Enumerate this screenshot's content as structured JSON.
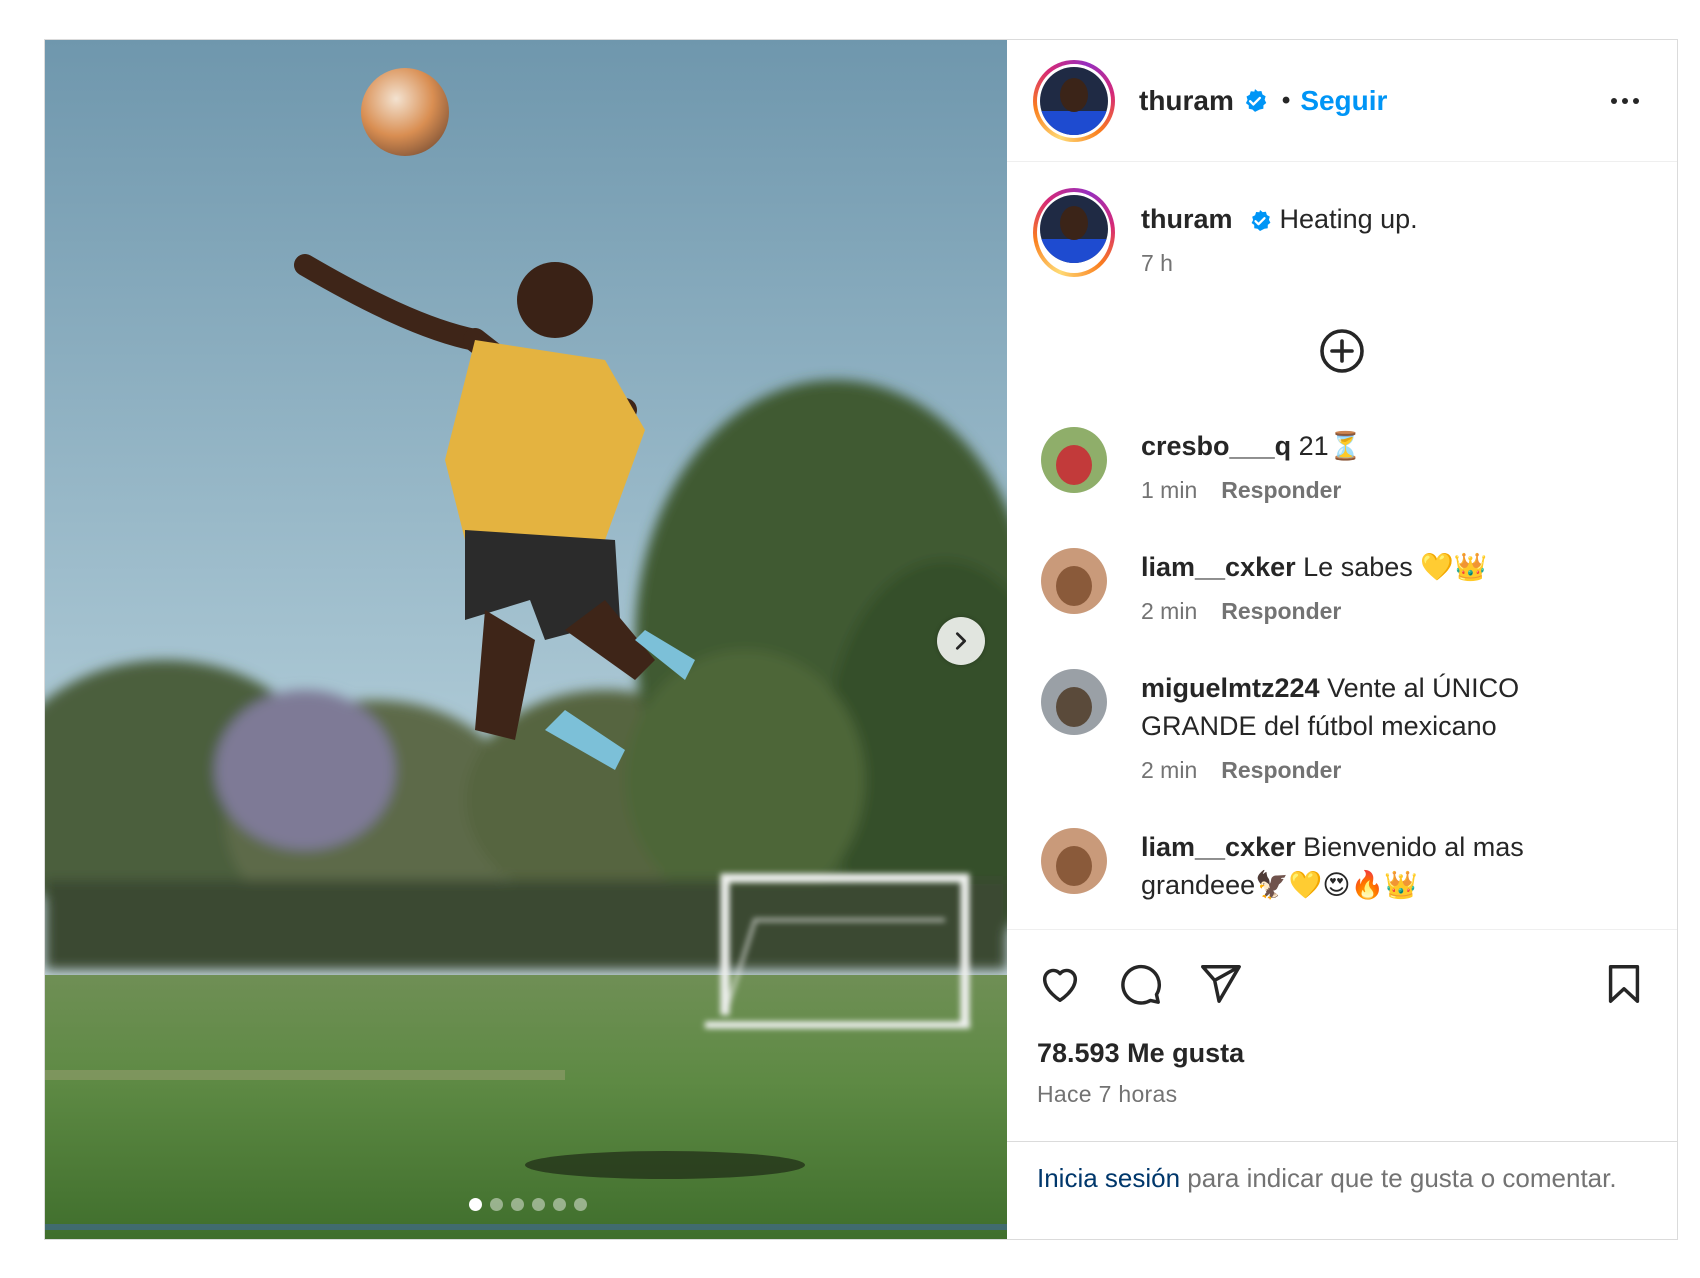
{
  "media": {
    "carousel_count": 6,
    "carousel_active": 1,
    "next_button": "chevron-right-icon"
  },
  "header": {
    "username": "thuram",
    "verified": true,
    "separator": "•",
    "follow_label": "Seguir",
    "more_icon": "more-horizontal-icon"
  },
  "caption": {
    "username": "thuram",
    "text": "Heating up.",
    "time": "7 h"
  },
  "load_more_icon": "plus-circle-icon",
  "comments": [
    {
      "username": "cresbo___q",
      "text": "21⏳",
      "time": "1 min",
      "reply_label": "Responder"
    },
    {
      "username": "liam__cxker",
      "text": "Le sabes 💛👑",
      "time": "2 min",
      "reply_label": "Responder"
    },
    {
      "username": "miguelmtz224",
      "text": "Vente al ÚNICO GRANDE del fútbol mexicano",
      "time": "2 min",
      "reply_label": "Responder"
    },
    {
      "username": "liam__cxker",
      "text": "Bienvenido al mas grandeee🦅💛😍🔥👑",
      "time": "",
      "reply_label": ""
    }
  ],
  "actions": {
    "like_icon": "heart-icon",
    "comment_icon": "comment-icon",
    "share_icon": "send-icon",
    "save_icon": "bookmark-icon"
  },
  "likes_text": "78.593 Me gusta",
  "timestamp": "Hace 7 horas",
  "login_prompt": {
    "link": "Inicia sesión",
    "rest": " para indicar que te gusta o comentar."
  },
  "colors": {
    "accent": "#0095f6",
    "link_dark": "#00376b",
    "text": "#262626",
    "muted": "#737373",
    "verified": "#0095f6"
  }
}
